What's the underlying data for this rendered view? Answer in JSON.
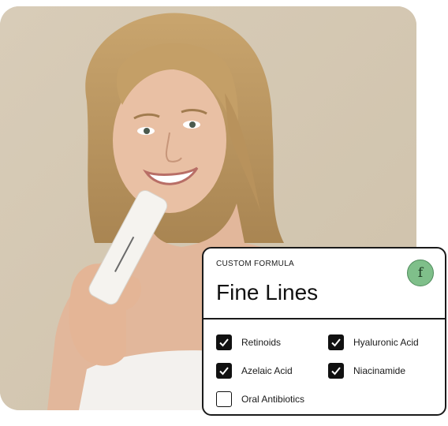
{
  "card": {
    "eyebrow": "CUSTOM FORMULA",
    "title": "Fine Lines",
    "badge_letter": "f",
    "ingredients": [
      {
        "label": "Retinoids",
        "checked": true
      },
      {
        "label": "Hyaluronic Acid",
        "checked": true
      },
      {
        "label": "Azelaic Acid",
        "checked": true
      },
      {
        "label": "Niacinamide",
        "checked": true
      },
      {
        "label": "Oral Antibiotics",
        "checked": false
      }
    ]
  },
  "colors": {
    "background": "#d6cbb8",
    "badge": "#7fbf8a",
    "checkbox": "#111111"
  }
}
